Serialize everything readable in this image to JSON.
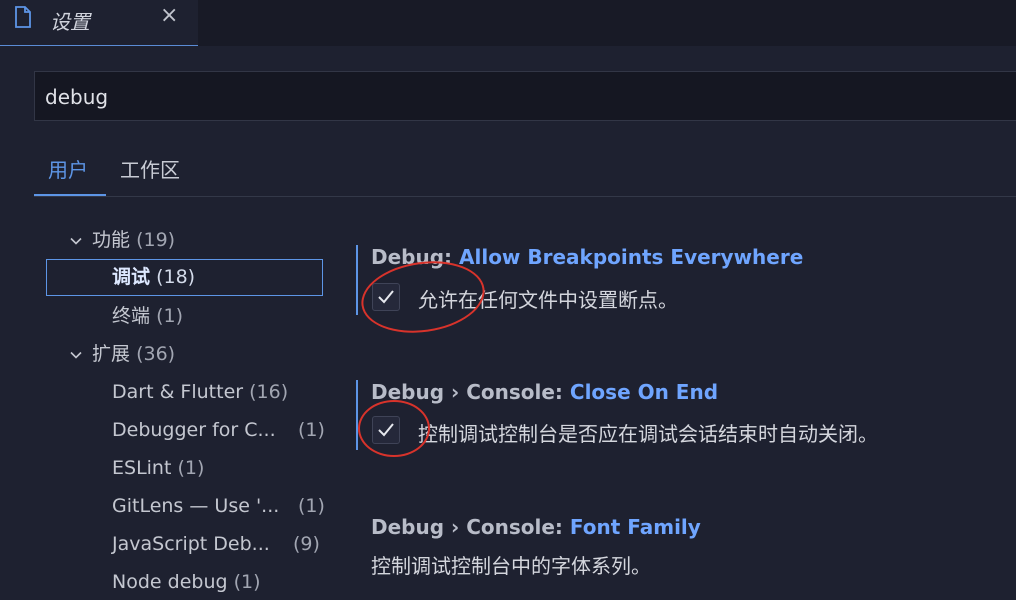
{
  "tab": {
    "title": "设置",
    "close_icon": "×"
  },
  "search": {
    "value": "debug"
  },
  "scope_tabs": {
    "user": "用户",
    "workspace": "工作区"
  },
  "tree": {
    "features": {
      "label": "功能",
      "count": "(19)"
    },
    "debug": {
      "label": "调试",
      "count": "(18)"
    },
    "terminal": {
      "label": "终端",
      "count": "(1)"
    },
    "extensions": {
      "label": "扩展",
      "count": "(36)"
    },
    "ext_items": [
      {
        "label": "Dart & Flutter",
        "count": "(16)"
      },
      {
        "label": "Debugger for C...",
        "count": "(1)"
      },
      {
        "label": "ESLint",
        "count": "(1)"
      },
      {
        "label": "GitLens — Use '...",
        "count": "(1)"
      },
      {
        "label": "JavaScript Deb...",
        "count": "(9)"
      },
      {
        "label": "Node debug",
        "count": "(1)"
      }
    ]
  },
  "settings": [
    {
      "prefix": "Debug: ",
      "key": "Allow Breakpoints Everywhere",
      "description": "允许在任何文件中设置断点。",
      "checked": true
    },
    {
      "prefix": "Debug › Console: ",
      "key": "Close On End",
      "description": "控制调试控制台是否应在调试会话结束时自动关闭。",
      "checked": true
    },
    {
      "prefix": "Debug › Console: ",
      "key": "Font Family",
      "description": "控制调试控制台中的字体系列。"
    }
  ],
  "colors": {
    "accent": "#5d95e6",
    "annotation": "#d8332b",
    "background": "#1e2130"
  }
}
